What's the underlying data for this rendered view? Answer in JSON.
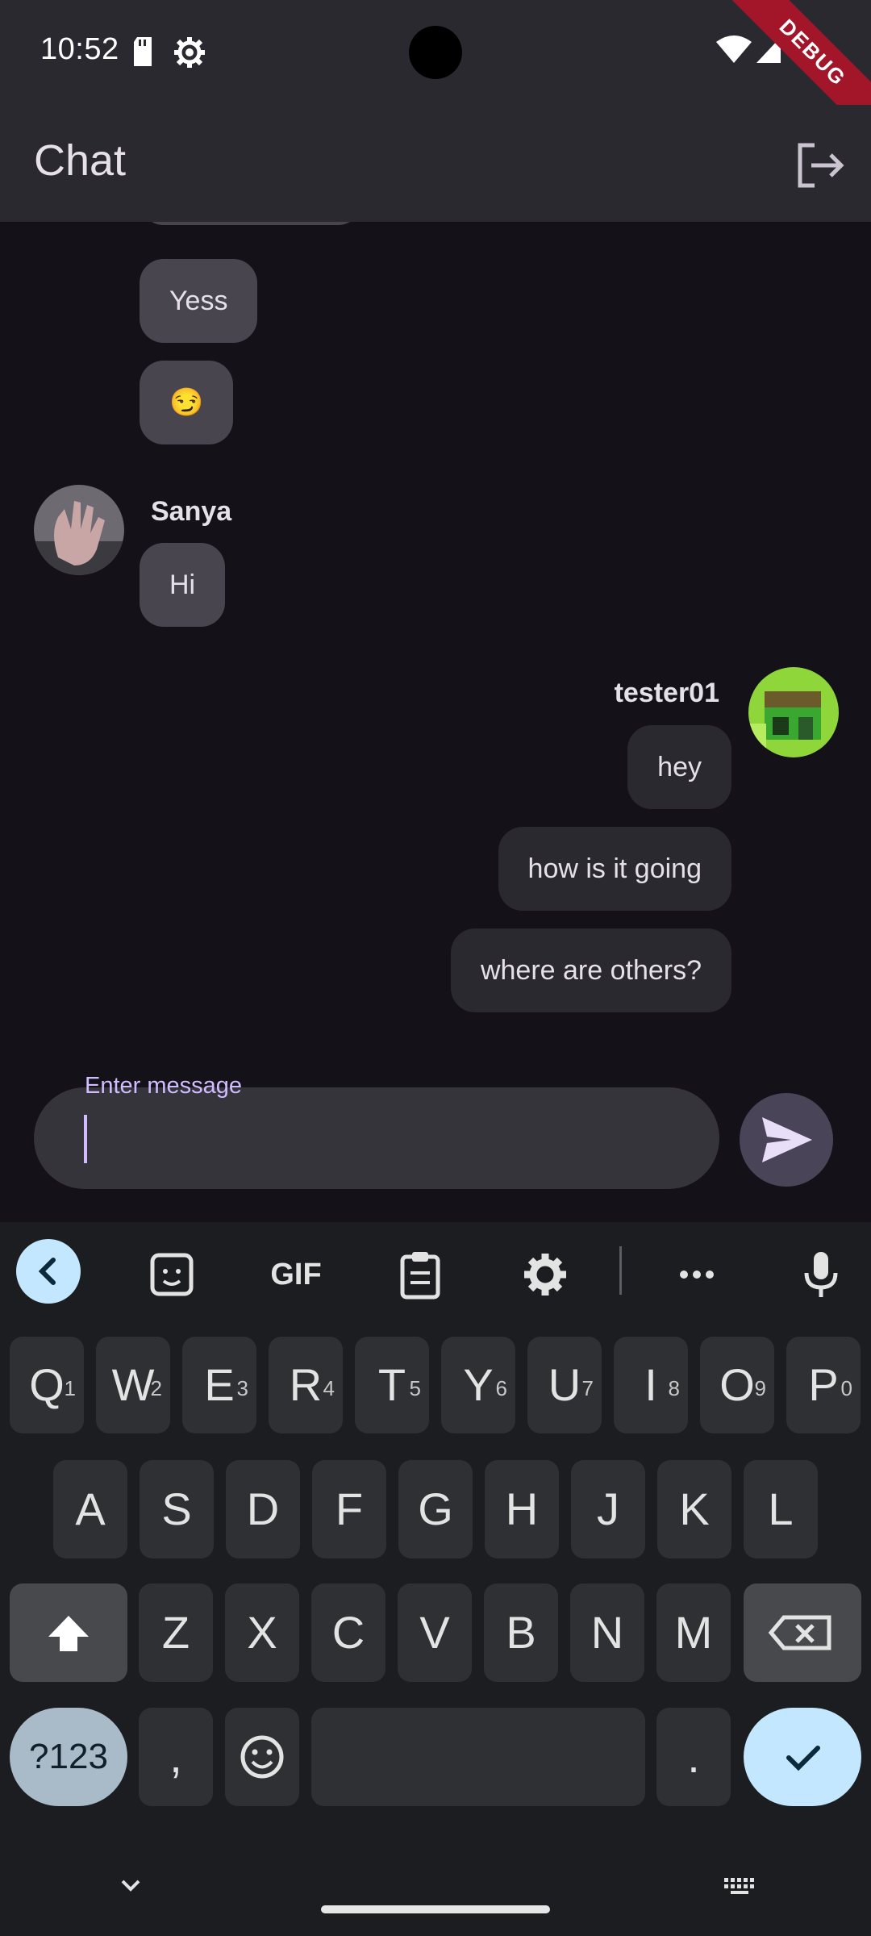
{
  "status_bar": {
    "time": "10:52",
    "icons": [
      "sd-card-icon",
      "settings-gear-icon",
      "wifi-icon",
      "signal-icon"
    ],
    "debug_banner": "DEBUG"
  },
  "app_bar": {
    "title": "Chat",
    "action_icon": "logout-icon"
  },
  "messages": [
    {
      "sender": "",
      "text": "Yess",
      "self": false
    },
    {
      "sender": "",
      "text": "😏",
      "self": false
    },
    {
      "sender": "Sanya",
      "text": "Hi",
      "self": false
    },
    {
      "sender": "tester01",
      "text": "hey",
      "self": true
    },
    {
      "sender": "",
      "text": "how is it going",
      "self": true
    },
    {
      "sender": "",
      "text": "where are others?",
      "self": true
    }
  ],
  "composer": {
    "label": "Enter message",
    "value": "",
    "send_icon": "send-icon"
  },
  "keyboard": {
    "toolbar": [
      "back-icon",
      "sticker-icon",
      "GIF",
      "clipboard-icon",
      "settings-icon",
      "more-icon",
      "mic-icon"
    ],
    "row1": [
      {
        "k": "Q",
        "n": "1"
      },
      {
        "k": "W",
        "n": "2"
      },
      {
        "k": "E",
        "n": "3"
      },
      {
        "k": "R",
        "n": "4"
      },
      {
        "k": "T",
        "n": "5"
      },
      {
        "k": "Y",
        "n": "6"
      },
      {
        "k": "U",
        "n": "7"
      },
      {
        "k": "I",
        "n": "8"
      },
      {
        "k": "O",
        "n": "9"
      },
      {
        "k": "P",
        "n": "0"
      }
    ],
    "row2": [
      "A",
      "S",
      "D",
      "F",
      "G",
      "H",
      "J",
      "K",
      "L"
    ],
    "row3": [
      "Z",
      "X",
      "C",
      "V",
      "B",
      "N",
      "M"
    ],
    "symbols_key": "?123",
    "comma_key": ",",
    "period_key": ".",
    "colors": {
      "accent": "#c3e7ff",
      "key": "#2e3033",
      "background": "#1b1d20"
    }
  }
}
